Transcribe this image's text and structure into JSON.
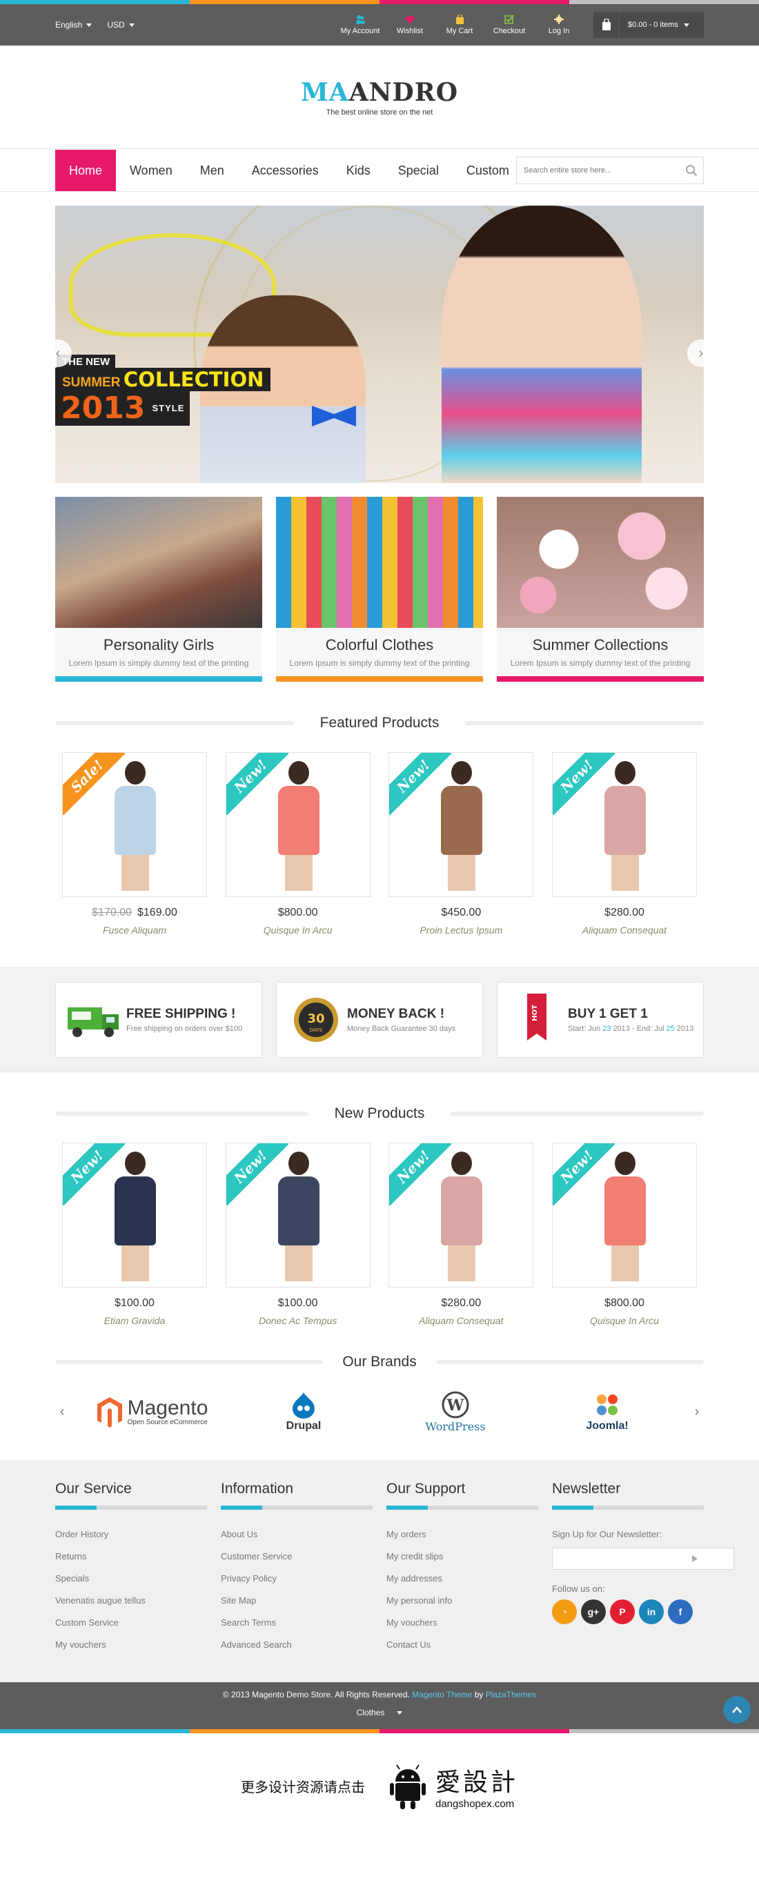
{
  "colors": {
    "accent_blue": "#29b6d6",
    "accent_pink": "#e8196b",
    "accent_orange": "#f7941d",
    "accent_gray": "#bfbfbf",
    "topbar_bg": "#5d5d5d"
  },
  "topbar": {
    "language": "English",
    "currency": "USD",
    "links": [
      {
        "label": "My Account",
        "icon": "account-icon",
        "color": "#29b6d6"
      },
      {
        "label": "Wishlist",
        "icon": "heart-icon",
        "color": "#e8196b"
      },
      {
        "label": "My Cart",
        "icon": "cart-icon",
        "color": "#f7c23a"
      },
      {
        "label": "Checkout",
        "icon": "check-icon",
        "color": "#8bc53f"
      },
      {
        "label": "Log In",
        "icon": "gear-icon",
        "color": "#f7e7a0"
      }
    ],
    "cart_summary": "$0.00 - 0 items"
  },
  "header": {
    "logo_part1": "MA",
    "logo_part2": "ANDRO",
    "tagline": "The best online store on the net"
  },
  "nav": {
    "items": [
      "Home",
      "Women",
      "Men",
      "Accessories",
      "Kids",
      "Special",
      "Custom M"
    ],
    "search_placeholder": "Search entire store here..."
  },
  "hero": {
    "line1": "THE NEW",
    "line2a": "SUMMER",
    "line2b": "COLLECTION",
    "year": "2013",
    "style": "STYLE"
  },
  "banners": [
    {
      "title": "Personality Girls",
      "text": "Lorem Ipsum is simply dummy text of the printing",
      "color": "#29b6d6"
    },
    {
      "title": "Colorful Clothes",
      "text": "Lorem Ipsum is simply dummy text of the printing",
      "color": "#f7941d"
    },
    {
      "title": "Summer Collections",
      "text": "Lorem Ipsum is simply dummy text of the printing",
      "color": "#e8196b"
    }
  ],
  "featured": {
    "title": "Featured Products",
    "products": [
      {
        "badge": "Sale!",
        "badge_color": "#f7941d",
        "old_price": "$170.00",
        "price": "$169.00",
        "name": "Fusce Aliquam",
        "top": "#bcd4e6"
      },
      {
        "badge": "New!",
        "badge_color": "#2bc7c0",
        "old_price": "",
        "price": "$800.00",
        "name": "Quisque In Arcu",
        "top": "#f07e72"
      },
      {
        "badge": "New!",
        "badge_color": "#2bc7c0",
        "old_price": "",
        "price": "$450.00",
        "name": "Proin Lectus Ipsum",
        "top": "#9a6a4e"
      },
      {
        "badge": "New!",
        "badge_color": "#2bc7c0",
        "old_price": "",
        "price": "$280.00",
        "name": "Aliquam Consequat",
        "top": "#d9a7a3"
      }
    ]
  },
  "services": [
    {
      "title": "FREE SHIPPING !",
      "text": "Free shipping on orders over $100",
      "icon": "truck-icon"
    },
    {
      "title": "MONEY BACK !",
      "text": "Money Back Guarantee 30 days",
      "icon": "badge-30-days-icon",
      "badge_number": "30",
      "badge_text": "DAYS"
    },
    {
      "title": "BUY 1 GET 1",
      "text_a": "Start: Jun ",
      "hl_a": "23",
      "text_b": " 2013 - End: Jul ",
      "hl_b": "25",
      "text_c": " 2013",
      "icon": "hot-tag-icon",
      "tag": "HOT"
    }
  ],
  "new_products": {
    "title": "New Products",
    "products": [
      {
        "badge": "New!",
        "badge_color": "#2bc7c0",
        "price": "$100.00",
        "name": "Etiam Gravida",
        "top": "#2b3350"
      },
      {
        "badge": "New!",
        "badge_color": "#2bc7c0",
        "price": "$100.00",
        "name": "Donec Ac Tempus",
        "top": "#3d4660"
      },
      {
        "badge": "New!",
        "badge_color": "#2bc7c0",
        "price": "$280.00",
        "name": "Aliquam Consequat",
        "top": "#d9a7a3"
      },
      {
        "badge": "New!",
        "badge_color": "#2bc7c0",
        "price": "$800.00",
        "name": "Quisque In Arcu",
        "top": "#f07e72"
      }
    ]
  },
  "brands": {
    "title": "Our Brands",
    "items": [
      {
        "name": "Magento",
        "sub": "Open Source eCommerce"
      },
      {
        "name": "Drupal",
        "sub": ""
      },
      {
        "name": "WordPress",
        "sub": ""
      },
      {
        "name": "Joomla!",
        "sub": ""
      }
    ]
  },
  "footer": {
    "columns": [
      {
        "title": "Our Service",
        "links": [
          "Order History",
          "Returns",
          "Specials",
          "Venenatis augue tellus",
          "Custom Service",
          "My vouchers"
        ]
      },
      {
        "title": "Information",
        "links": [
          "About Us",
          "Customer Service",
          "Privacy Policy",
          "Site Map",
          "Search Terms",
          "Advanced Search"
        ]
      },
      {
        "title": "Our Support",
        "links": [
          "My orders",
          "My credit slips",
          "My addresses",
          "My personal info",
          "My vouchers",
          "Contact Us"
        ]
      }
    ],
    "newsletter": {
      "title": "Newsletter",
      "label": "Sign Up for Our Newsletter:",
      "follow": "Follow us on:",
      "socials": [
        {
          "name": "rss-icon",
          "glyph": "◔",
          "color": "#f39c12"
        },
        {
          "name": "google-plus-icon",
          "glyph": "g+",
          "color": "#333333"
        },
        {
          "name": "pinterest-icon",
          "glyph": "P",
          "color": "#e41f34"
        },
        {
          "name": "linkedin-icon",
          "glyph": "in",
          "color": "#1b86b8"
        },
        {
          "name": "facebook-icon",
          "glyph": "f",
          "color": "#2d6cc0"
        }
      ]
    }
  },
  "bottombar": {
    "copyright": "© 2013 Magento Demo Store. All Rights Reserved.",
    "theme_link": "Magento Theme",
    "by": "by",
    "author_link": "PlazaThemes",
    "store_select": "Clothes"
  },
  "watermark": {
    "cn_text": "更多设计资源请点击",
    "big": "愛設計",
    "domain": "dangshopex.com"
  }
}
